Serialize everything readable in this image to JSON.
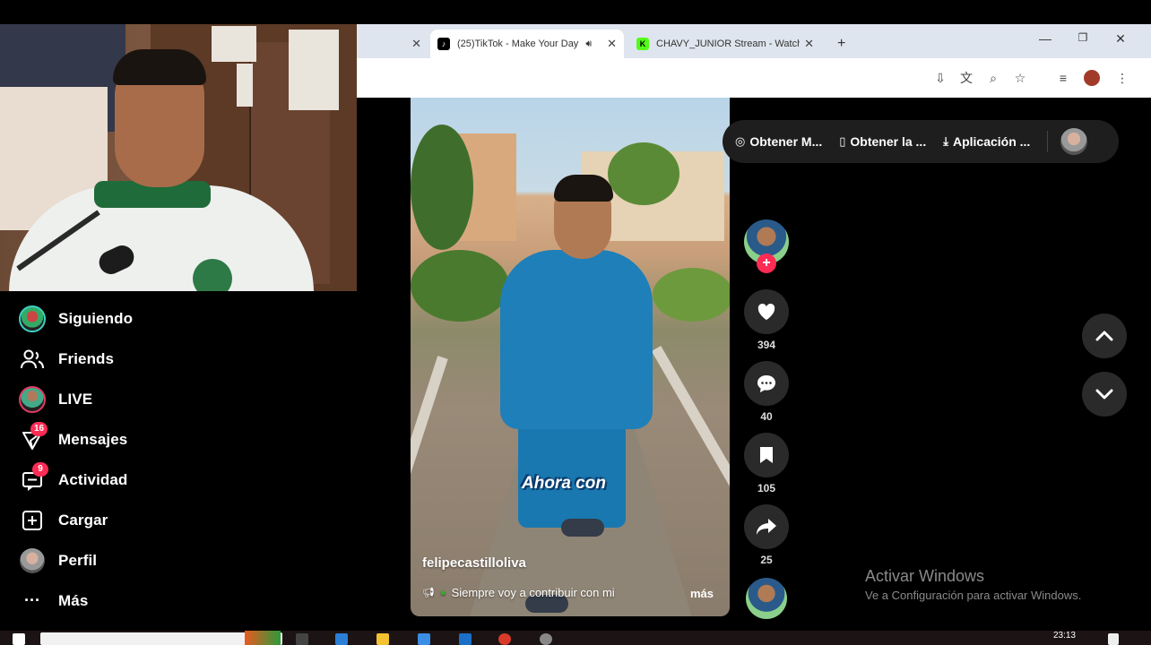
{
  "browser": {
    "tabs": [
      {
        "label": "",
        "active": false
      },
      {
        "label": "(25)TikTok - Make Your Day",
        "active": true,
        "favicon": "tiktok-icon"
      },
      {
        "label": "CHAVY_JUNIOR Stream - Watch",
        "active": false,
        "favicon": "kick-icon"
      }
    ],
    "new_tab": "+"
  },
  "sidebar": {
    "items": [
      {
        "label": "Siguiendo",
        "icon": "following-avatar"
      },
      {
        "label": "Friends",
        "icon": "friends-icon"
      },
      {
        "label": "LIVE",
        "icon": "live-avatar"
      },
      {
        "label": "Mensajes",
        "icon": "messages-icon",
        "badge": "16"
      },
      {
        "label": "Actividad",
        "icon": "activity-icon",
        "badge": "9"
      },
      {
        "label": "Cargar",
        "icon": "upload-icon"
      },
      {
        "label": "Perfil",
        "icon": "profile-avatar"
      },
      {
        "label": "Más",
        "icon": "more-icon"
      }
    ]
  },
  "topbar": {
    "get_coins": "Obtener M...",
    "get_app": "Obtener la ...",
    "download_app": "Aplicación ..."
  },
  "video": {
    "caption": "Ahora con",
    "author": "felipecastilloliva",
    "description": "Siempre voy a contribuir con mi",
    "more": "más"
  },
  "actions": {
    "likes": "394",
    "comments": "40",
    "saves": "105",
    "shares": "25"
  },
  "watermark": {
    "title": "Activar Windows",
    "subtitle": "Ve a Configuración para activar Windows."
  },
  "taskbar": {
    "clock": "23:13"
  },
  "colors": {
    "accent": "#fe2c55",
    "background": "#000000",
    "following_ring": "#3ed1c4"
  }
}
